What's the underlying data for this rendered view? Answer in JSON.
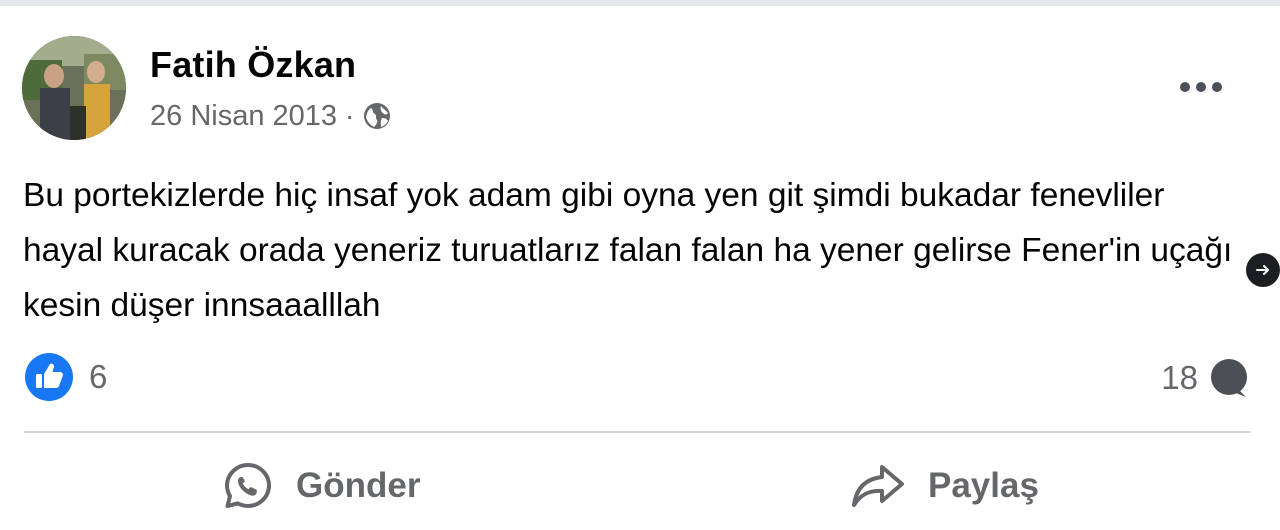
{
  "post": {
    "author": "Fatih Özkan",
    "date": "26 Nisan 2013",
    "separator": "·",
    "privacy_icon": "globe-icon",
    "text": "Bu portekizlerde hiç insaf yok adam gibi oyna yen git şimdi bukadar fenevliler hayal kuracak orada yeneriz turuatlarız falan falan ha yener gelirse Fener'in uçağı kesin düşer innsaaalllah"
  },
  "stats": {
    "reaction_count": "6",
    "comment_count": "18",
    "reaction_icon": "like-icon",
    "comment_icon": "comment-bubble-icon"
  },
  "actions": {
    "send_label": "Gönder",
    "share_label": "Paylaş"
  },
  "colors": {
    "primary_text": "#050505",
    "secondary_text": "#65676b",
    "like_blue": "#1877f2",
    "divider": "#ced0d4"
  }
}
